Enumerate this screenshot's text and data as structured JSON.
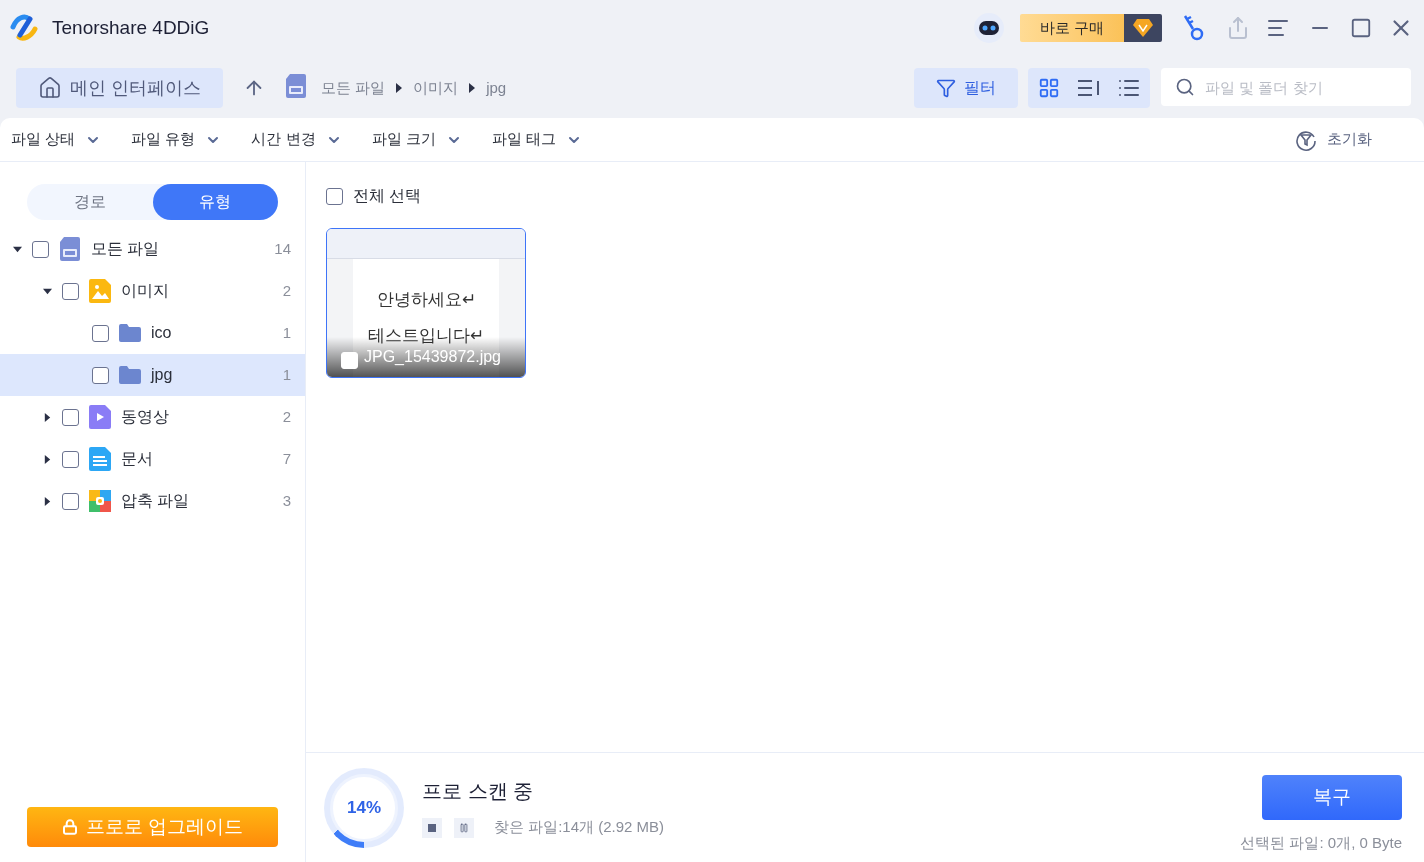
{
  "app": {
    "title": "Tenorshare 4DDiG",
    "buy_button": "바로 구매"
  },
  "toolbar": {
    "home_button": "메인 인터페이스",
    "breadcrumb": [
      "모든 파일",
      "이미지",
      "jpg"
    ],
    "filter_button": "필터",
    "views": [
      {
        "kind": "grid",
        "selected": true
      },
      {
        "kind": "detail",
        "selected": false
      },
      {
        "kind": "list",
        "selected": false
      }
    ],
    "search": {
      "placeholder": "파일 및 폴더 찾기"
    }
  },
  "filters": [
    "파일 상태",
    "파일 유형",
    "시간 변경",
    "파일 크기",
    "파일 태그"
  ],
  "reset_button": "초기화",
  "sidebar": {
    "tabs": [
      {
        "label": "경로",
        "selected": false
      },
      {
        "label": "유형",
        "selected": true
      }
    ],
    "tree": [
      {
        "label": "모든 파일",
        "count": "14",
        "kind": "sd",
        "checked": false,
        "selected": false,
        "expanded": true,
        "children": [
          {
            "label": "이미지",
            "count": "2",
            "kind": "image",
            "checked": false,
            "selected": false,
            "expanded": true,
            "children": [
              {
                "label": "ico",
                "count": "1",
                "kind": "folder",
                "checked": false,
                "selected": false
              },
              {
                "label": "jpg",
                "count": "1",
                "kind": "folder",
                "checked": false,
                "selected": true
              }
            ]
          },
          {
            "label": "동영상",
            "count": "2",
            "kind": "video",
            "checked": false,
            "selected": false,
            "expanded": false
          },
          {
            "label": "문서",
            "count": "7",
            "kind": "document",
            "checked": false,
            "selected": false,
            "expanded": false
          },
          {
            "label": "압축 파일",
            "count": "3",
            "kind": "archive",
            "checked": false,
            "selected": false,
            "expanded": false
          }
        ]
      }
    ],
    "upgrade_button": "프로로 업그레이드"
  },
  "content": {
    "select_all": {
      "label": "전체 선택",
      "checked": false
    },
    "files": [
      {
        "name": "JPG_15439872.jpg",
        "checked": false,
        "preview_lines": [
          "안녕하세요↵",
          "테스트입니다↵"
        ]
      }
    ]
  },
  "scan": {
    "percent": "14%",
    "title": "프로 스캔 중",
    "found": "찾은 파일:14개 (2.92 MB)",
    "recover_button": "복구",
    "selected_info": "선택된 파일: 0개, 0 Byte"
  }
}
